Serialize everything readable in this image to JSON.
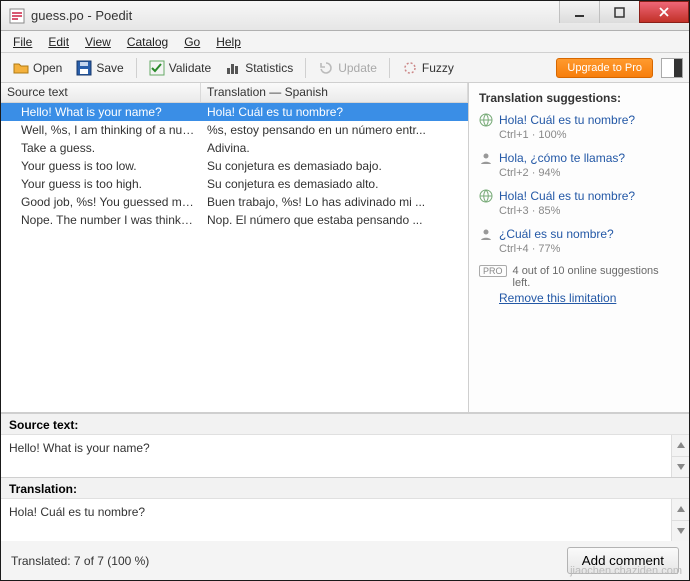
{
  "title": "guess.po - Poedit",
  "menu": {
    "file": "File",
    "edit": "Edit",
    "view": "View",
    "catalog": "Catalog",
    "go": "Go",
    "help": "Help"
  },
  "toolbar": {
    "open": "Open",
    "save": "Save",
    "validate": "Validate",
    "statistics": "Statistics",
    "update": "Update",
    "fuzzy": "Fuzzy",
    "upgrade": "Upgrade to Pro"
  },
  "columns": {
    "source": "Source text",
    "translation": "Translation — Spanish"
  },
  "rows": [
    {
      "src": "Hello! What is your name?",
      "trn": "Hola! Cuál es tu nombre?",
      "selected": true
    },
    {
      "src": "Well, %s, I am thinking of a number b...",
      "trn": "%s, estoy pensando en un número entr..."
    },
    {
      "src": "Take a guess.",
      "trn": "Adivina."
    },
    {
      "src": "Your guess is too low.",
      "trn": "Su conjetura es demasiado bajo."
    },
    {
      "src": "Your guess is too high.",
      "trn": "Su conjetura es demasiado alto."
    },
    {
      "src": "Good job, %s! You guessed my numb...",
      "trn": "Buen trabajo, %s! Lo has adivinado mi ..."
    },
    {
      "src": "Nope. The number I was thinking of ...",
      "trn": "Nop. El número que estaba pensando ..."
    }
  ],
  "suggestions": {
    "title": "Translation suggestions:",
    "items": [
      {
        "icon": "globe",
        "text": "Hola! Cuál es tu nombre?",
        "meta": "Ctrl+1 · 100%"
      },
      {
        "icon": "person",
        "text": "Hola, ¿cómo te llamas?",
        "meta": "Ctrl+2 · 94%"
      },
      {
        "icon": "globe",
        "text": "Hola! Cuál es tu nombre?",
        "meta": "Ctrl+3 · 85%"
      },
      {
        "icon": "person",
        "text": "¿Cuál es su nombre?",
        "meta": "Ctrl+4 · 77%"
      }
    ],
    "pro_note": "4 out of 10 online suggestions left.",
    "pro_link": "Remove this limitation"
  },
  "editor": {
    "source_label": "Source text:",
    "source_value": "Hello! What is your name?",
    "translation_label": "Translation:",
    "translation_value": "Hola! Cuál es tu nombre?"
  },
  "footer": {
    "status": "Translated: 7 of 7 (100 %)",
    "add_comment": "Add comment"
  },
  "watermark": "jiaochen.chaziden.com"
}
